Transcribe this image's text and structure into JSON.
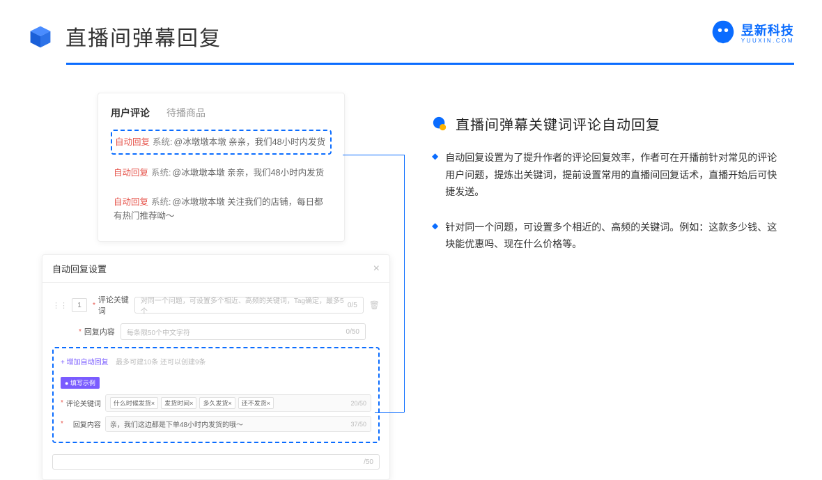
{
  "header": {
    "title": "直播间弹幕回复",
    "brand_cn": "昱新科技",
    "brand_en": "YUUXIN.COM"
  },
  "comments_panel": {
    "tab_active": "用户评论",
    "tab_inactive": "待播商品",
    "rows": [
      {
        "auto": "自动回复",
        "sys": "系统:",
        "text": "@冰墩墩本墩 亲亲，我们48小时内发货"
      },
      {
        "auto": "自动回复",
        "sys": "系统:",
        "text": "@冰墩墩本墩 亲亲，我们48小时内发货"
      },
      {
        "auto": "自动回复",
        "sys": "系统:",
        "text": "@冰墩墩本墩 关注我们的店铺，每日都有热门推荐呦～"
      }
    ]
  },
  "settings": {
    "title": "自动回复设置",
    "num": "1",
    "kw_label": "评论关键词",
    "kw_placeholder": "对同一个问题，可设置多个相近、高频的关键词，Tag确定，最多5个",
    "kw_count": "0/5",
    "content_label": "回复内容",
    "content_placeholder": "每条限50个中文字符",
    "content_count": "0/50",
    "add_link": "+ 增加自动回复",
    "add_hint": "最多可建10条 还可以创建9条",
    "example_badge": "● 填写示例",
    "ex_kw_label": "评论关键词",
    "ex_tags": [
      "什么时候发货×",
      "发货时间×",
      "多久发货×",
      "还不发货×"
    ],
    "ex_kw_count": "20/50",
    "ex_content_label": "回复内容",
    "ex_content_text": "亲，我们这边都是下单48小时内发货的哦～",
    "ex_content_count": "37/50",
    "below_count": "/50"
  },
  "right": {
    "section_title": "直播间弹幕关键词评论自动回复",
    "bullets": [
      "自动回复设置为了提升作者的评论回复效率，作者可在开播前针对常见的评论用户问题，提炼出关键词，提前设置常用的直播间回复话术，直播开始后可快捷发送。",
      "针对同一个问题，可设置多个相近的、高频的关键词。例如：这款多少钱、这块能优惠吗、现在什么价格等。"
    ]
  }
}
